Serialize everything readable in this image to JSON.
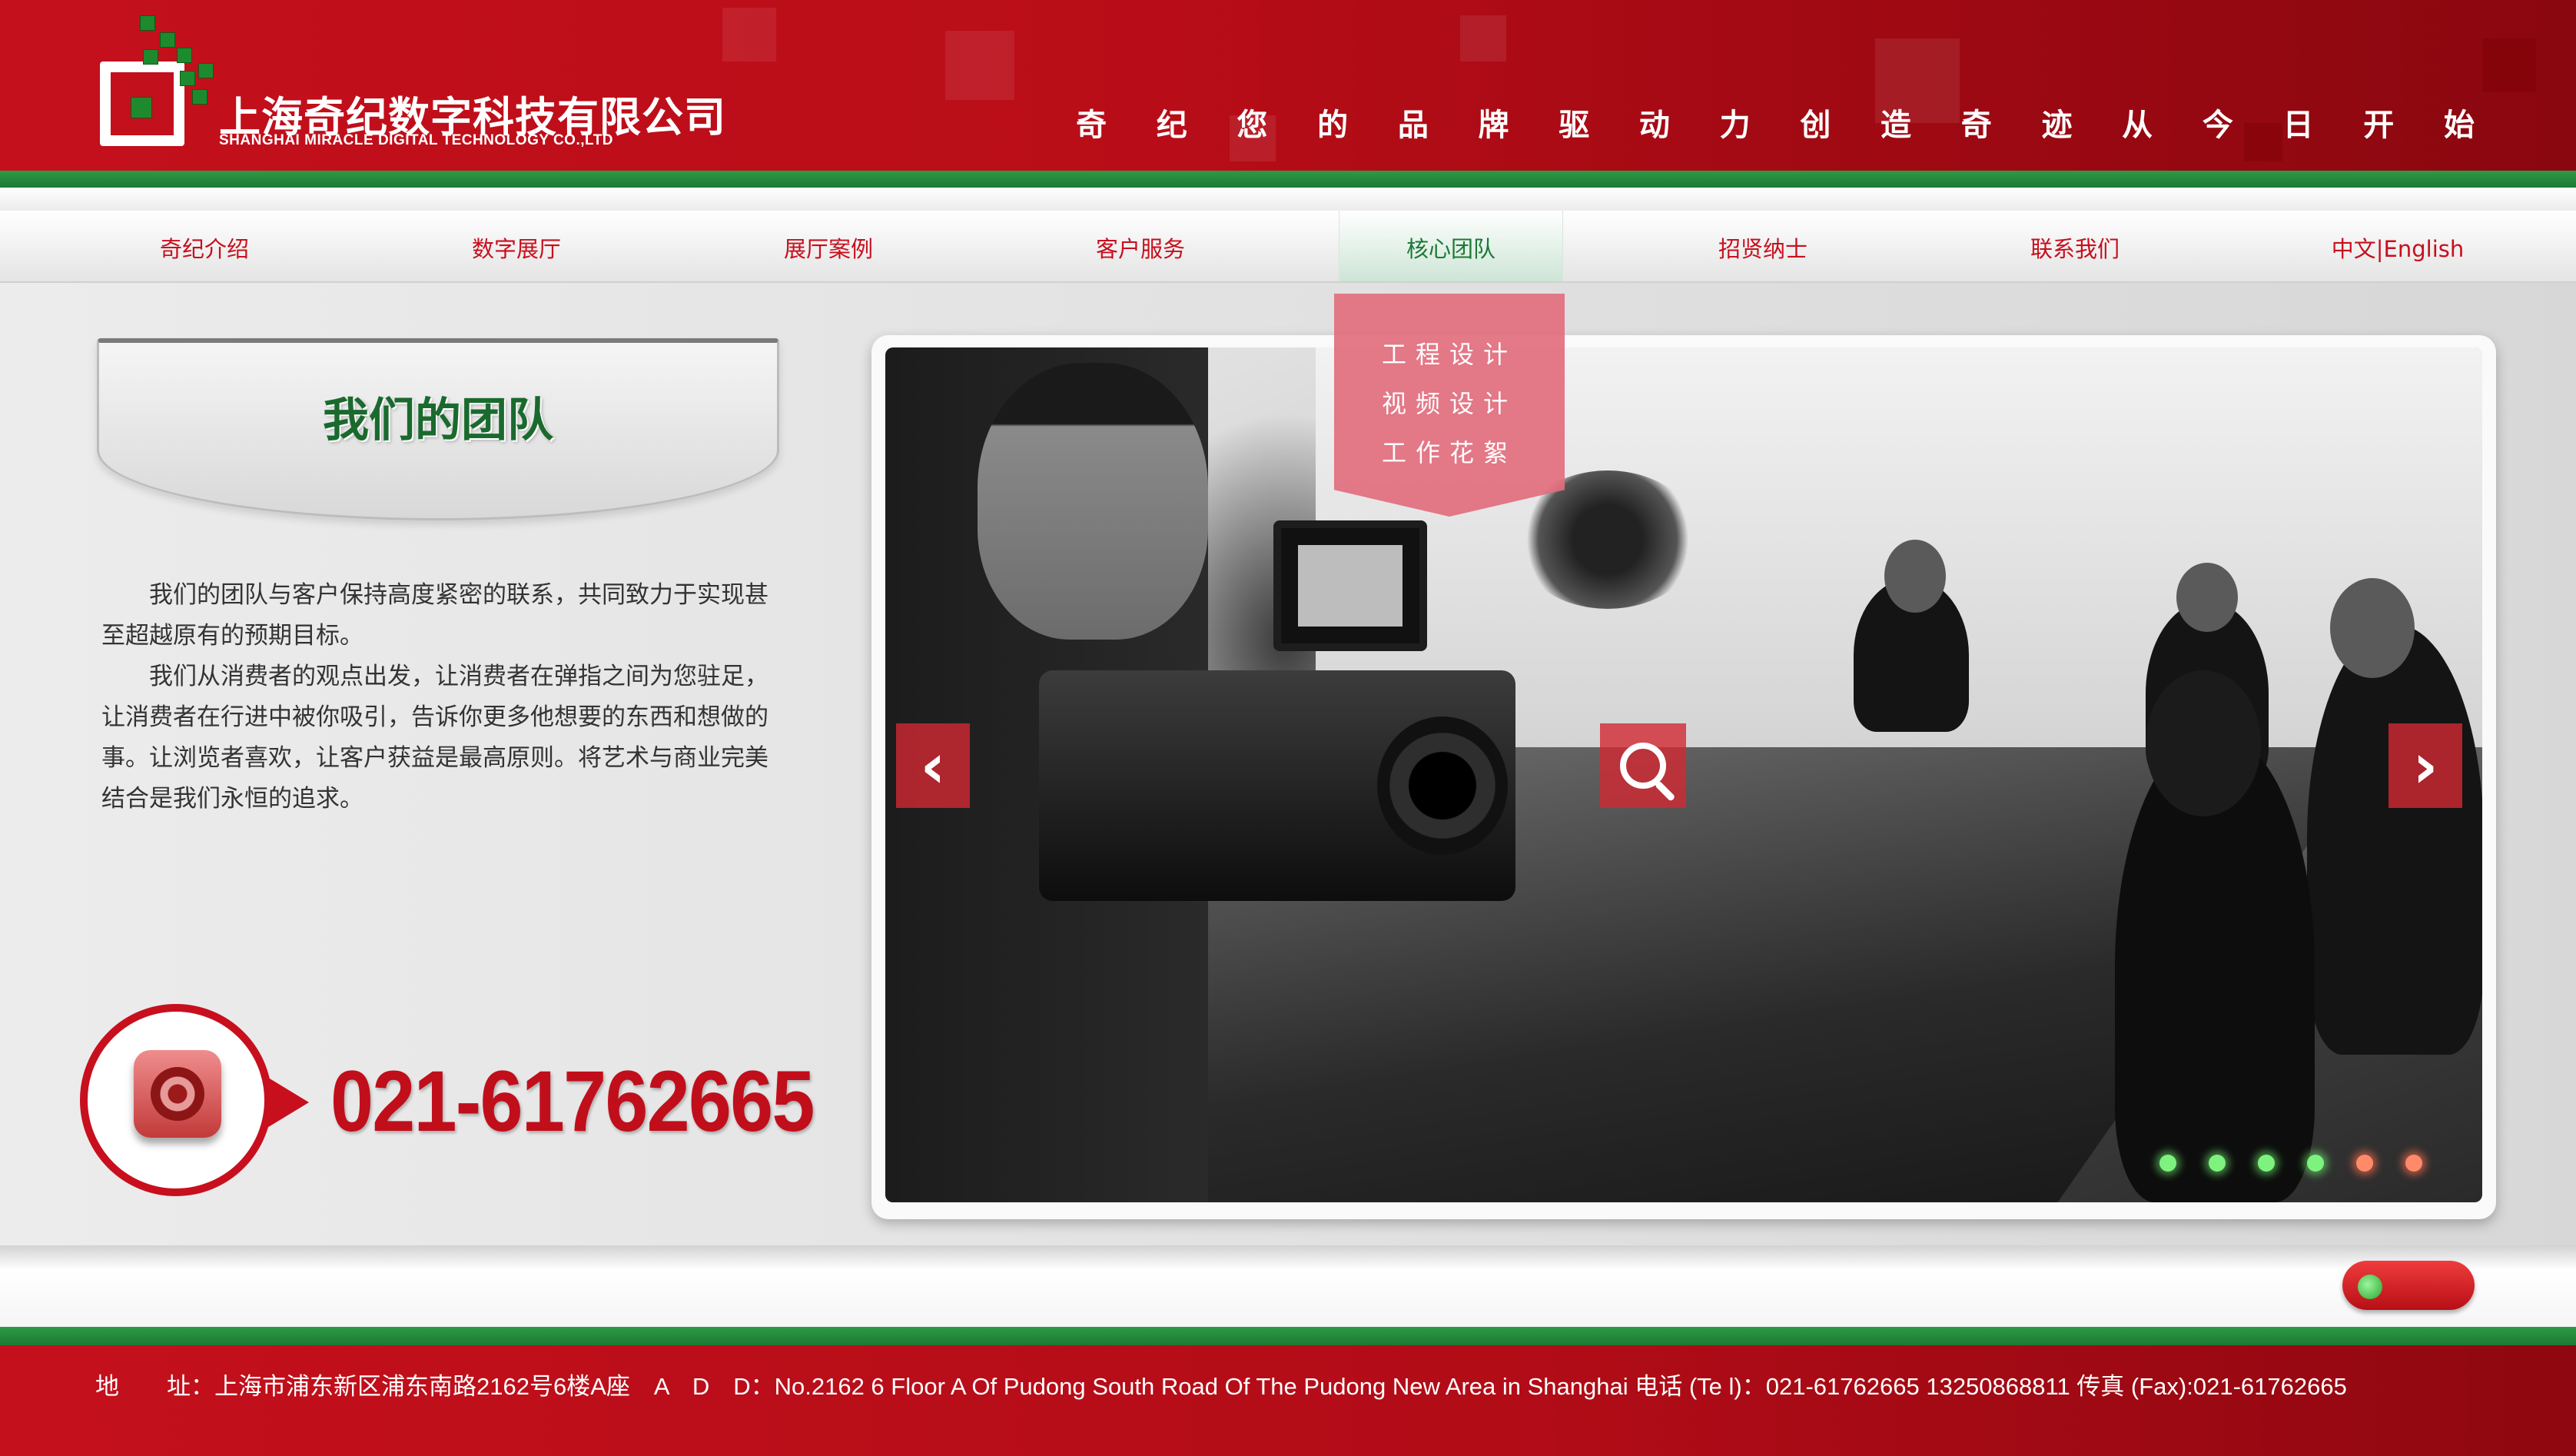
{
  "company": {
    "name_cn": "上海奇纪数字科技有限公司",
    "name_en": "SHANGHAI MIRACLE DIGITAL TECHNOLOGY CO.,LTD"
  },
  "slogan": [
    "奇",
    "纪",
    "您",
    "的",
    "品",
    "牌",
    "驱",
    "动",
    "力",
    "创",
    "造",
    "奇",
    "迹",
    "从",
    "今",
    "日",
    "开",
    "始"
  ],
  "nav": {
    "items": [
      "奇纪介绍",
      "数字展厅",
      "展厅案例",
      "客户服务",
      "核心团队",
      "招贤纳士",
      "联系我们",
      "中文|English"
    ],
    "active_index": 4
  },
  "dropdown": [
    "工程设计",
    "视频设计",
    "工作花絮"
  ],
  "team": {
    "title": "我们的团队",
    "paragraph1": "我们的团队与客户保持高度紧密的联系，共同致力于实现甚至超越原有的预期目标。",
    "paragraph2": "我们从消费者的观点出发，让消费者在弹指之间为您驻足，让消费者在行进中被你吸引，告诉你更多他想要的东西和想做的事。让浏览者喜欢，让客户获益是最高原则。将艺术与商业完美结合是我们永恒的追求。"
  },
  "phone": "021-61762665",
  "slideshow": {
    "prev_icon": "chevron-left-icon",
    "next_icon": "chevron-right-icon",
    "zoom_icon": "magnifier-icon",
    "dots": [
      "green",
      "green",
      "green",
      "green",
      "red",
      "red"
    ]
  },
  "footer": {
    "address": "地　　址：上海市浦东新区浦东南路2162号6楼A座　A　D　D：No.2162 6 Floor A Of Pudong South Road Of The Pudong New Area in Shanghai  电话 (Te l)：021-61762665 13250868811  传真 (Fax):021-61762665"
  },
  "colors": {
    "brand_red": "#c80f1d",
    "brand_green": "#1c7a33"
  }
}
